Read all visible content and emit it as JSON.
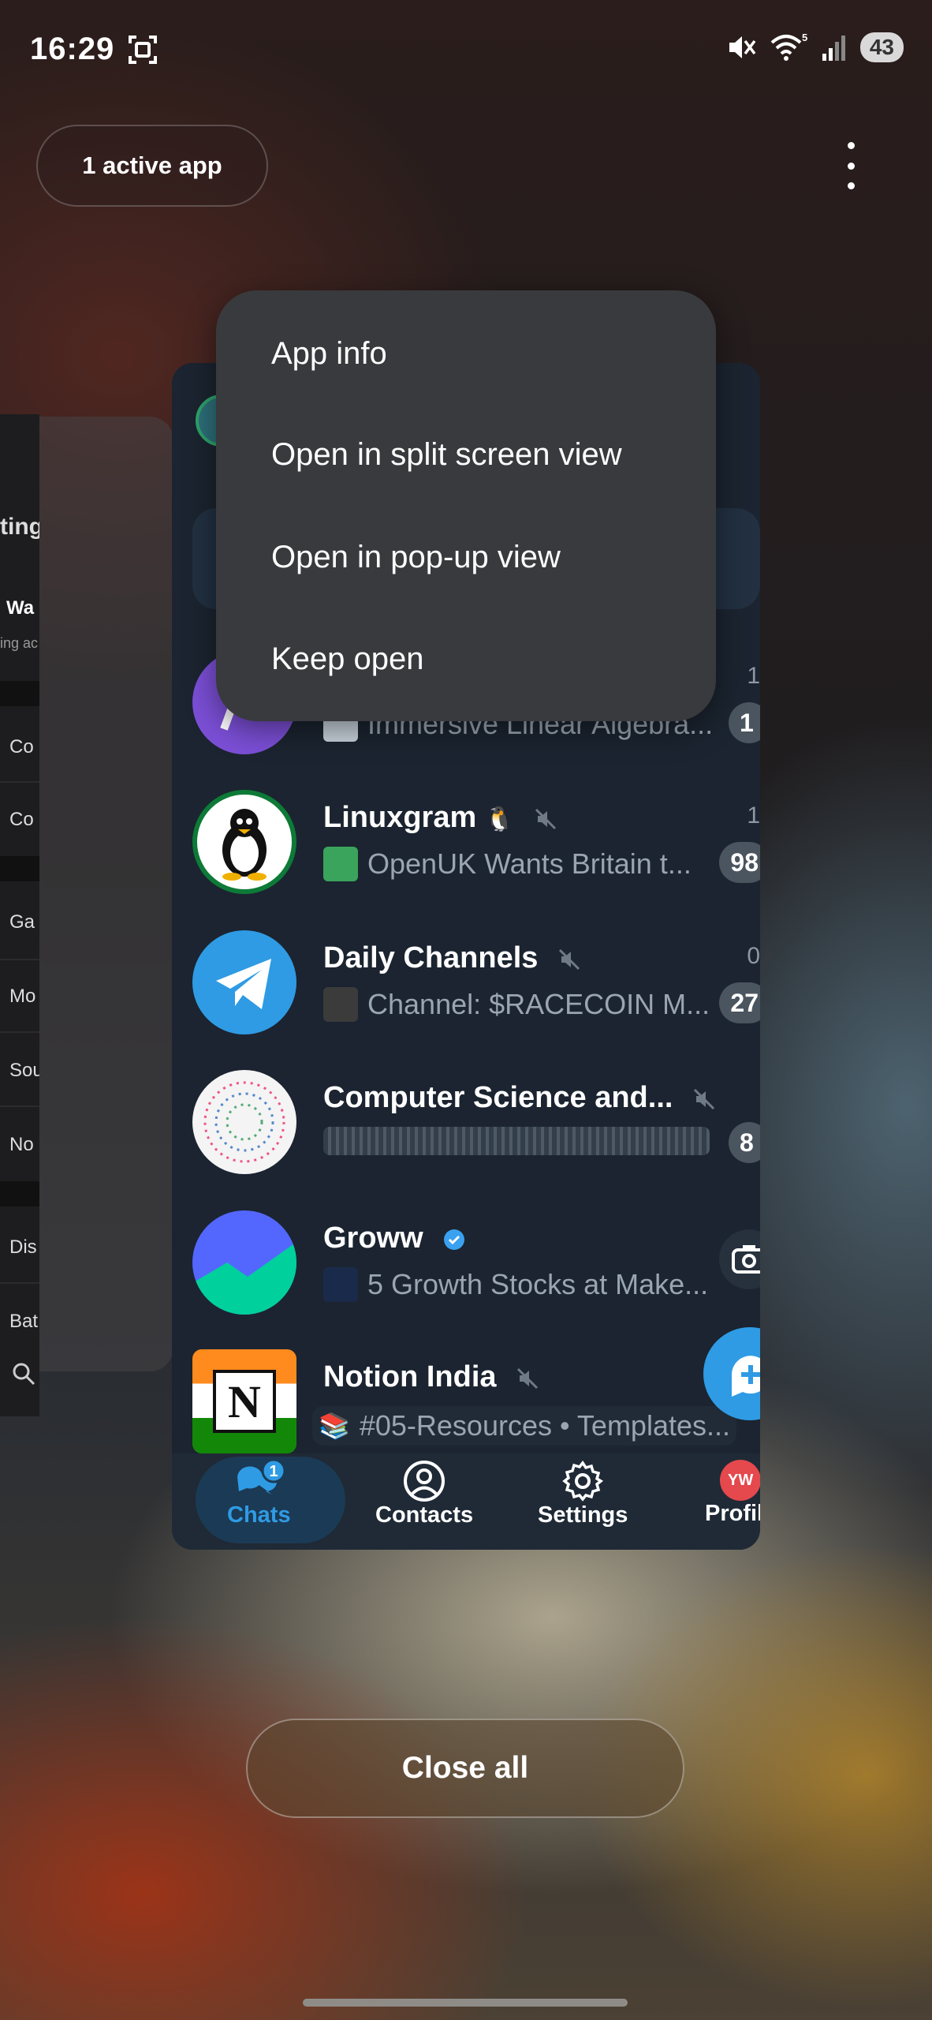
{
  "status_bar": {
    "time": "16:29",
    "battery": "43",
    "wifi_badge": "5"
  },
  "recents": {
    "active_apps_label": "1 active app",
    "close_all_label": "Close all"
  },
  "settings_preview": {
    "title": "ting",
    "rows": [
      "Wa",
      "ing ac",
      "Co",
      "Co",
      "Ga",
      "Mo",
      "Sou",
      "No",
      "Dis",
      "Bat"
    ]
  },
  "context_menu": {
    "items": [
      "App info",
      "Open in split screen view",
      "Open in pop-up view",
      "Keep open"
    ]
  },
  "telegram": {
    "chats": [
      {
        "name": "",
        "preview": "Immersive Linear Algebra...",
        "time": "1",
        "unread": "1",
        "avatar_color": "#7b4fd6"
      },
      {
        "name": "Linuxgram",
        "preview": "OpenUK Wants Britain t...",
        "time": "1",
        "unread": "98",
        "muted": true
      },
      {
        "name": "Daily Channels",
        "preview": "Channel: $RACECOIN  M...",
        "time": "0",
        "unread": "27",
        "muted": true
      },
      {
        "name": "Computer Science and...",
        "preview": "",
        "time": "",
        "unread": "8",
        "muted": true
      },
      {
        "name": "Groww",
        "preview": "5 Growth Stocks at Make...",
        "time": "",
        "unread": "",
        "verified": true
      },
      {
        "name": "Notion India",
        "preview": "#05-Resources • Templates...",
        "time": "",
        "unread": "",
        "muted": true
      }
    ],
    "tabs": [
      {
        "label": "Chats",
        "badge": "1",
        "active": true
      },
      {
        "label": "Contacts"
      },
      {
        "label": "Settings"
      },
      {
        "label": "Profile",
        "avatar_initials": "YW"
      }
    ],
    "accent": "#2f9be4"
  }
}
